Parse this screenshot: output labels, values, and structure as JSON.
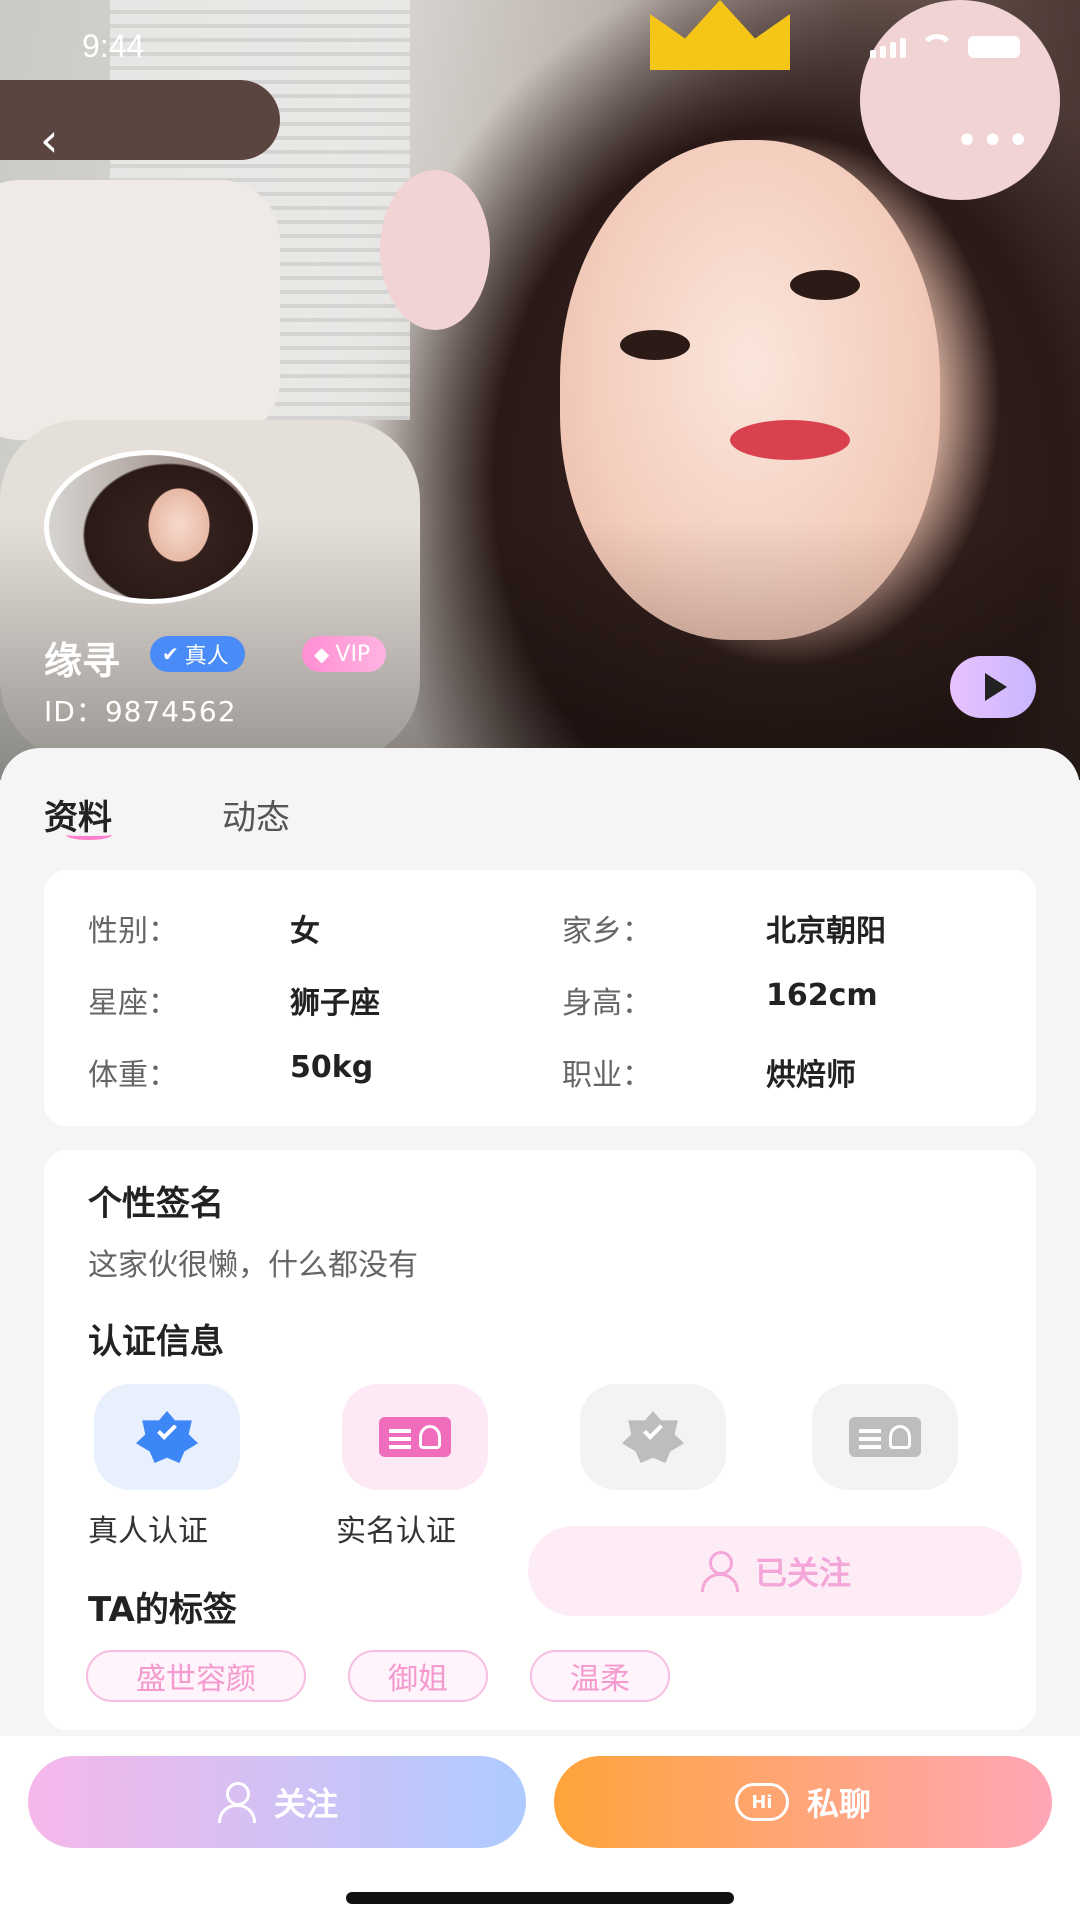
{
  "status_bar": {
    "time": "9:44"
  },
  "profile": {
    "name": "缘寻",
    "badge_real": "真人",
    "badge_vip": "VIP",
    "id_text": "ID：9874562"
  },
  "tabs": [
    {
      "label": "资料",
      "active": true
    },
    {
      "label": "动态",
      "active": false
    }
  ],
  "info": {
    "gender_label": "性别：",
    "gender_value": "女",
    "hometown_label": "家乡：",
    "hometown_value": "北京朝阳",
    "zodiac_label": "星座：",
    "zodiac_value": "狮子座",
    "height_label": "身高：",
    "height_value": "162cm",
    "weight_label": "体重：",
    "weight_value": "50kg",
    "job_label": "职业：",
    "job_value": "烘焙师"
  },
  "signature": {
    "title": "个性签名",
    "text": "这家伙很懒，什么都没有"
  },
  "certification": {
    "title": "认证信息",
    "items": [
      {
        "label": "真人认证",
        "icon": "verified-shield-icon",
        "active": true,
        "color": "#3d86f5"
      },
      {
        "label": "实名认证",
        "icon": "id-card-icon",
        "active": true,
        "color": "#f06dbb"
      },
      {
        "label": "",
        "icon": "verified-shield-icon",
        "active": false,
        "color": "#bdbdbd"
      },
      {
        "label": "",
        "icon": "id-card-icon",
        "active": false,
        "color": "#bdbdbd"
      }
    ]
  },
  "followed_button": {
    "label": "已关注"
  },
  "tags": {
    "title": "TA的标签",
    "items": [
      "盛世容颜",
      "御姐",
      "温柔"
    ]
  },
  "actions": {
    "follow_label": "关注",
    "chat_label": "私聊",
    "chat_icon_text": "Hi"
  },
  "colors": {
    "accent_pink": "#ff7fcf",
    "real_badge": "#4a8cf7",
    "chat_orange": "#ffa43a"
  }
}
